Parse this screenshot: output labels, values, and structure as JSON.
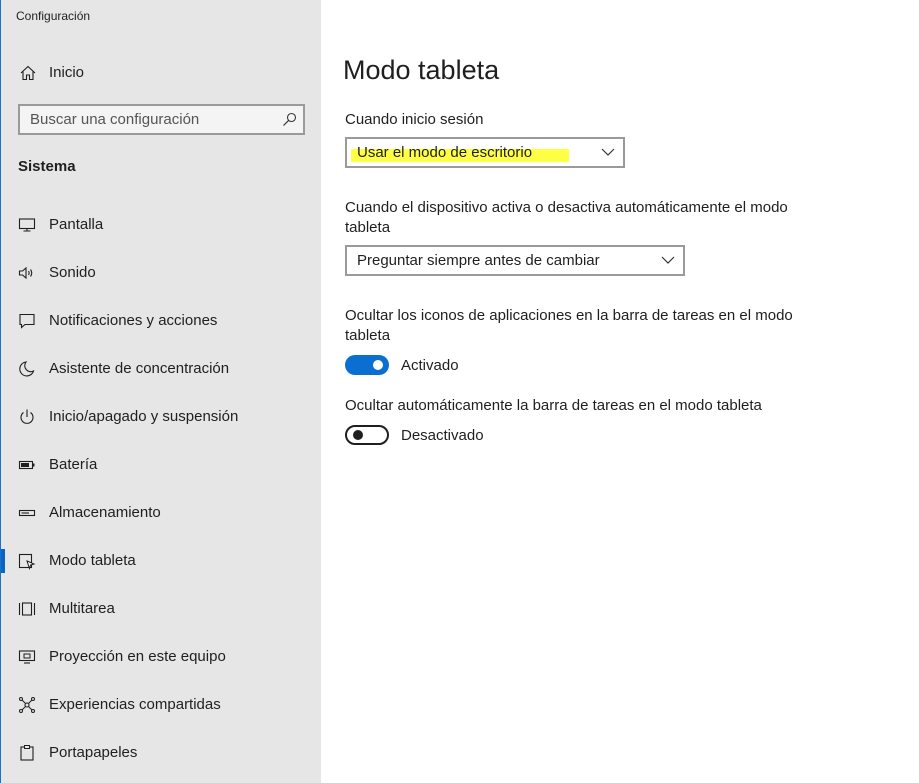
{
  "window": {
    "title": "Configuración"
  },
  "sidebar": {
    "home_label": "Inicio",
    "search": {
      "placeholder": "Buscar una configuración"
    },
    "section_label": "Sistema",
    "items": [
      {
        "label": "Pantalla",
        "icon": "monitor-icon"
      },
      {
        "label": "Sonido",
        "icon": "speaker-icon"
      },
      {
        "label": "Notificaciones y acciones",
        "icon": "notification-icon"
      },
      {
        "label": "Asistente de concentración",
        "icon": "moon-icon"
      },
      {
        "label": "Inicio/apagado y suspensión",
        "icon": "power-icon"
      },
      {
        "label": "Batería",
        "icon": "battery-icon"
      },
      {
        "label": "Almacenamiento",
        "icon": "storage-icon"
      },
      {
        "label": "Modo tableta",
        "icon": "tablet-icon",
        "selected": true
      },
      {
        "label": "Multitarea",
        "icon": "multitask-icon"
      },
      {
        "label": "Proyección en este equipo",
        "icon": "projection-icon"
      },
      {
        "label": "Experiencias compartidas",
        "icon": "shared-experiences-icon"
      },
      {
        "label": "Portapapeles",
        "icon": "clipboard-icon"
      }
    ]
  },
  "main": {
    "title": "Modo tableta",
    "signin": {
      "label": "Cuando inicio sesión",
      "value": "Usar el modo de escritorio"
    },
    "auto_switch": {
      "label": "Cuando el dispositivo activa o desactiva automáticamente el modo tableta",
      "value": "Preguntar siempre antes de cambiar"
    },
    "hide_icons": {
      "label": "Ocultar los iconos de aplicaciones en la barra de tareas en el modo tableta",
      "state": "Activado",
      "on": true
    },
    "hide_taskbar": {
      "label": "Ocultar automáticamente la barra de tareas en el modo tableta",
      "state": "Desactivado",
      "on": false
    }
  },
  "colors": {
    "accent": "#0a6fd1",
    "sidebar_bg": "#e6e6e6",
    "highlight": "#ffff3a"
  }
}
